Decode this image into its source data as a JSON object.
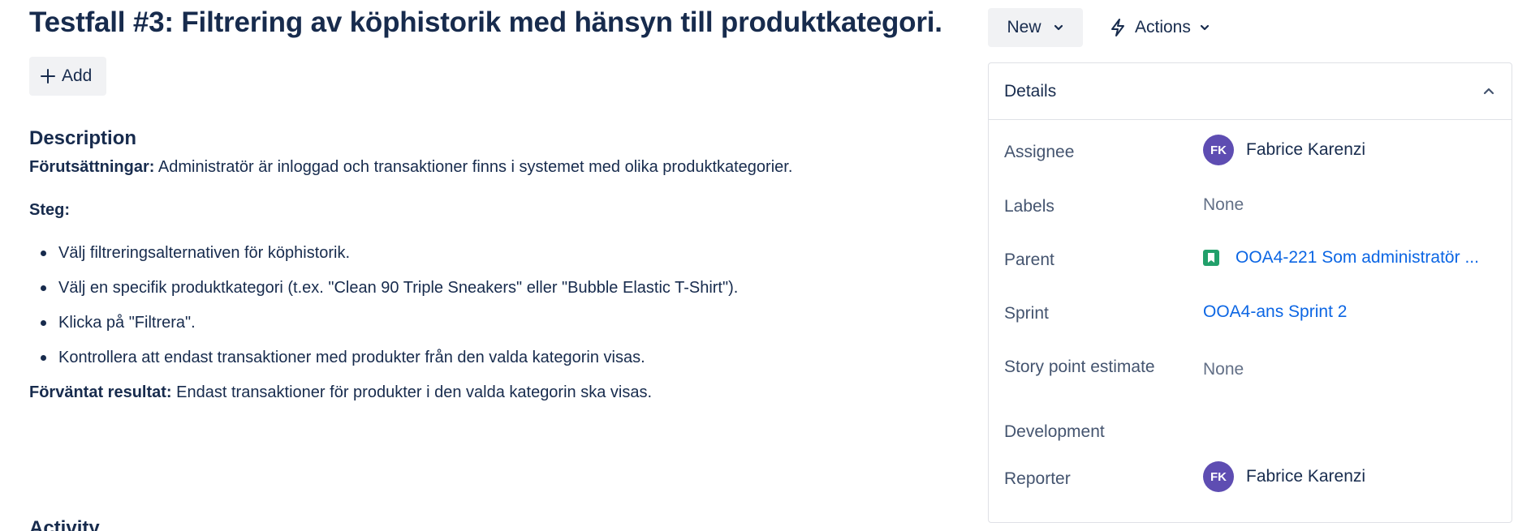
{
  "issue": {
    "title": "Testfall #3: Filtrering av köphistorik med hänsyn till produktkategori.",
    "add_label": "Add"
  },
  "description": {
    "heading": "Description",
    "preconditions_label": "Förutsättningar:",
    "preconditions_text": " Administratör är inloggad och transaktioner finns i systemet med olika produktkategorier.",
    "steps_label": "Steg:",
    "steps": [
      "Välj filtreringsalternativen för köphistorik.",
      "Välj en specifik produktkategori (t.ex. \"Clean 90 Triple Sneakers\" eller \"Bubble Elastic T-Shirt\").",
      "Klicka på \"Filtrera\".",
      "Kontrollera att endast transaktioner med produkter från den valda kategorin visas."
    ],
    "expected_label": "Förväntat resultat:",
    "expected_text": " Endast transaktioner för produkter i den valda kategorin ska visas."
  },
  "activity": {
    "heading": "Activity"
  },
  "toolbar": {
    "new_label": "New",
    "actions_label": "Actions"
  },
  "details": {
    "header": "Details",
    "assignee": {
      "label": "Assignee",
      "initials": "FK",
      "name": "Fabrice Karenzi"
    },
    "labels": {
      "label": "Labels",
      "value": "None"
    },
    "parent": {
      "label": "Parent",
      "value": "OOA4-221 Som administratör ..."
    },
    "sprint": {
      "label": "Sprint",
      "value": "OOA4-ans Sprint 2"
    },
    "story_points": {
      "label": "Story point estimate",
      "value": "None"
    },
    "development": {
      "label": "Development"
    },
    "reporter": {
      "label": "Reporter",
      "initials": "FK",
      "name": "Fabrice Karenzi"
    }
  },
  "colors": {
    "text": "#172b4d",
    "subtle": "#44546f",
    "link": "#0c66e4",
    "avatar": "#5e4db2",
    "story": "#22a06b",
    "button_bg": "#f1f2f4"
  }
}
